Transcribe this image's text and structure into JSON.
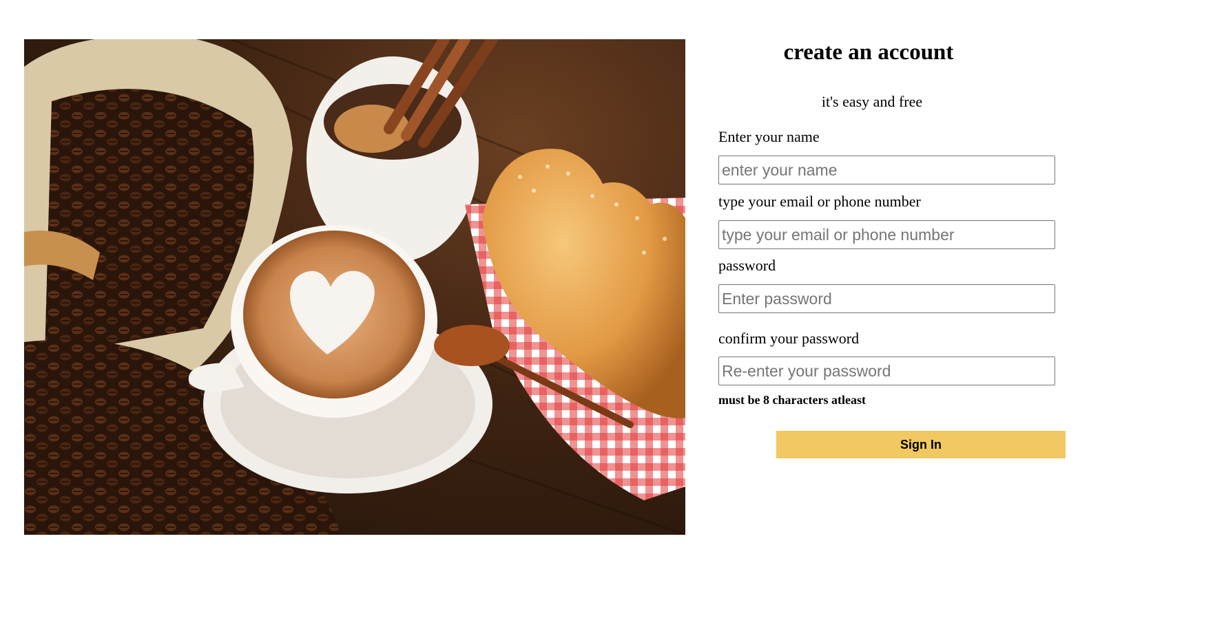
{
  "form": {
    "title": "create an account",
    "subtitle": "it's easy and free",
    "name_label": "Enter your name",
    "name_placeholder": "enter your name",
    "contact_label": "type your email or phone number",
    "contact_placeholder": "type your email or phone number",
    "password_label": "password",
    "password_placeholder": "Enter password",
    "confirm_label": "confirm your password",
    "confirm_placeholder": "Re-enter your password",
    "hint": "must be 8 characters atleast",
    "submit_label": "Sign In"
  },
  "colors": {
    "submit_bg": "#f1c861"
  }
}
